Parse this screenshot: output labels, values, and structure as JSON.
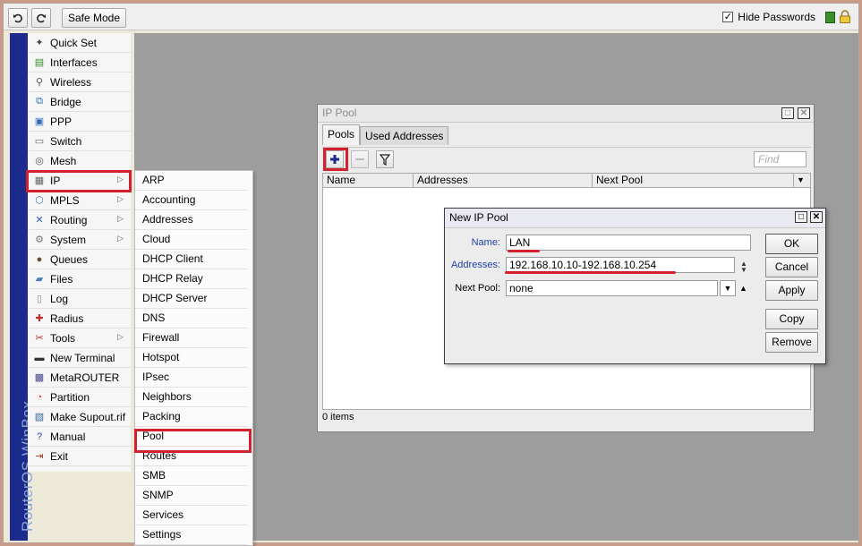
{
  "toolbar": {
    "safe_mode_label": "Safe Mode",
    "hide_passwords_label": "Hide Passwords",
    "hide_passwords_checked": "✓"
  },
  "brand": {
    "text": "RouterOS WinBox"
  },
  "menu": {
    "items": [
      {
        "label": "Quick Set",
        "icon": "wand-icon"
      },
      {
        "label": "Interfaces",
        "icon": "interfaces-icon"
      },
      {
        "label": "Wireless",
        "icon": "antenna-icon"
      },
      {
        "label": "Bridge",
        "icon": "bridge-icon"
      },
      {
        "label": "PPP",
        "icon": "ppp-icon"
      },
      {
        "label": "Switch",
        "icon": "switch-icon"
      },
      {
        "label": "Mesh",
        "icon": "mesh-icon"
      },
      {
        "label": "IP",
        "icon": "ip-icon"
      },
      {
        "label": "MPLS",
        "icon": "mpls-icon"
      },
      {
        "label": "Routing",
        "icon": "routing-icon"
      },
      {
        "label": "System",
        "icon": "gear-icon"
      },
      {
        "label": "Queues",
        "icon": "queues-icon"
      },
      {
        "label": "Files",
        "icon": "folder-icon"
      },
      {
        "label": "Log",
        "icon": "log-icon"
      },
      {
        "label": "Radius",
        "icon": "radius-icon"
      },
      {
        "label": "Tools",
        "icon": "tools-icon"
      },
      {
        "label": "New Terminal",
        "icon": "terminal-icon"
      },
      {
        "label": "MetaROUTER",
        "icon": "metarouter-icon"
      },
      {
        "label": "Partition",
        "icon": "pie-icon"
      },
      {
        "label": "Make Supout.rif",
        "icon": "supout-icon"
      },
      {
        "label": "Manual",
        "icon": "help-icon"
      },
      {
        "label": "Exit",
        "icon": "exit-icon"
      }
    ]
  },
  "submenu": {
    "items": [
      "ARP",
      "Accounting",
      "Addresses",
      "Cloud",
      "DHCP Client",
      "DHCP Relay",
      "DHCP Server",
      "DNS",
      "Firewall",
      "Hotspot",
      "IPsec",
      "Neighbors",
      "Packing",
      "Pool",
      "Routes",
      "SMB",
      "SNMP",
      "Services",
      "Settings"
    ]
  },
  "ip_pool_window": {
    "title": "IP Pool",
    "tabs": [
      "Pools",
      "Used Addresses"
    ],
    "find_placeholder": "Find",
    "columns": [
      "Name",
      "Addresses",
      "Next Pool"
    ],
    "status": "0 items"
  },
  "new_pool_dialog": {
    "title": "New IP Pool",
    "name_label": "Name:",
    "name_value": "LAN",
    "addresses_label": "Addresses:",
    "addresses_value": "192.168.10.10-192.168.10.254",
    "next_pool_label": "Next Pool:",
    "next_pool_value": "none",
    "buttons": {
      "ok": "OK",
      "cancel": "Cancel",
      "apply": "Apply",
      "copy": "Copy",
      "remove": "Remove"
    }
  },
  "colors": {
    "highlight_red": "#d2212d",
    "brand_blue": "#1c2b8c",
    "workspace_gray": "#9d9d9d"
  }
}
